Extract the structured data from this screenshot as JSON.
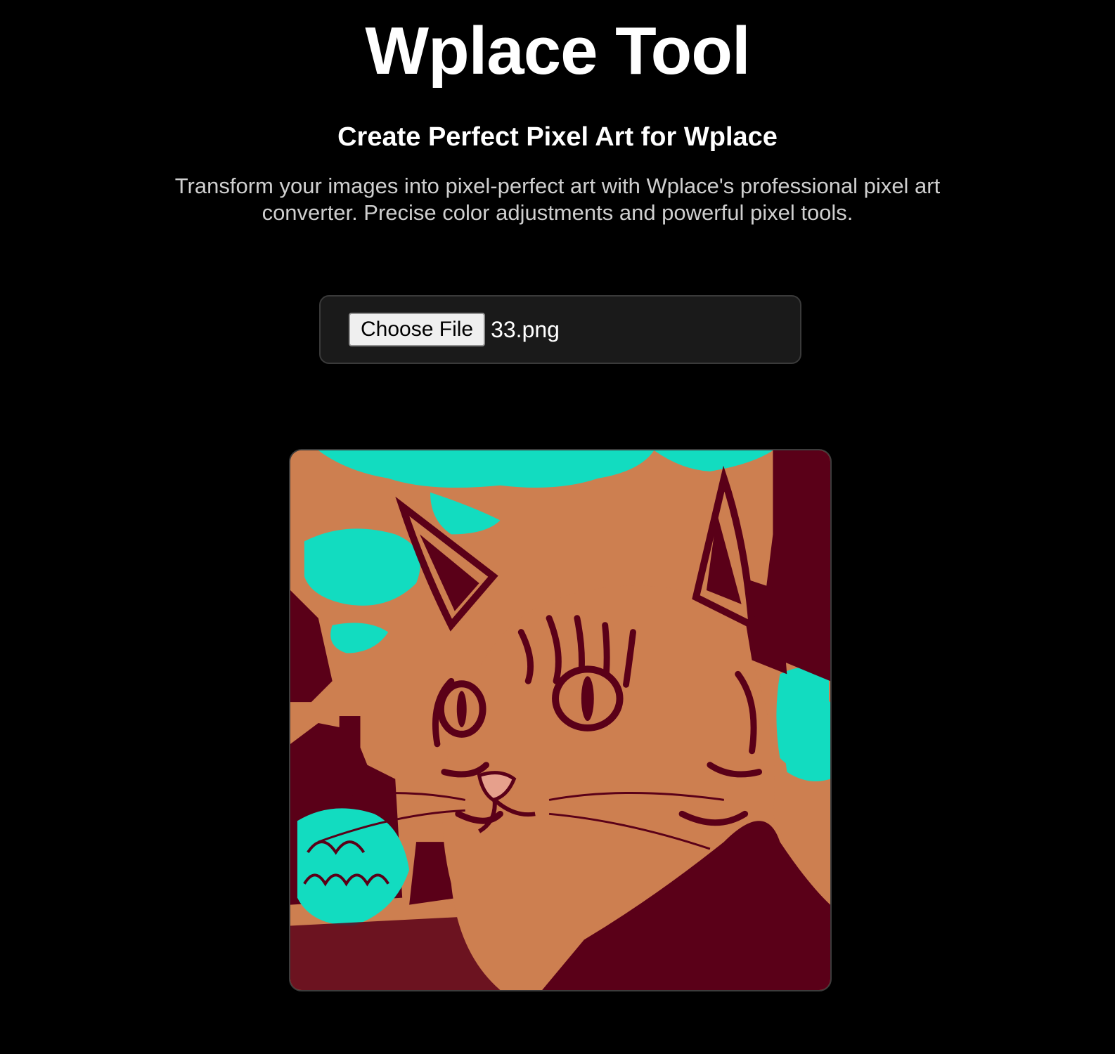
{
  "header": {
    "title": "Wplace Tool",
    "subtitle": "Create Perfect Pixel Art for Wplace",
    "description": "Transform your images into pixel-perfect art with Wplace's professional pixel art converter. Precise color adjustments and powerful pixel tools."
  },
  "upload": {
    "button_label": "Choose File",
    "file_name": "33.png"
  },
  "preview": {
    "subject": "pixel-art tabby cat portrait with street buildings and graffiti",
    "palette": {
      "background": "#cd7f50",
      "sky": "#12dcc0",
      "shadow": "#5a0018",
      "nose": "#e6a08c"
    }
  }
}
